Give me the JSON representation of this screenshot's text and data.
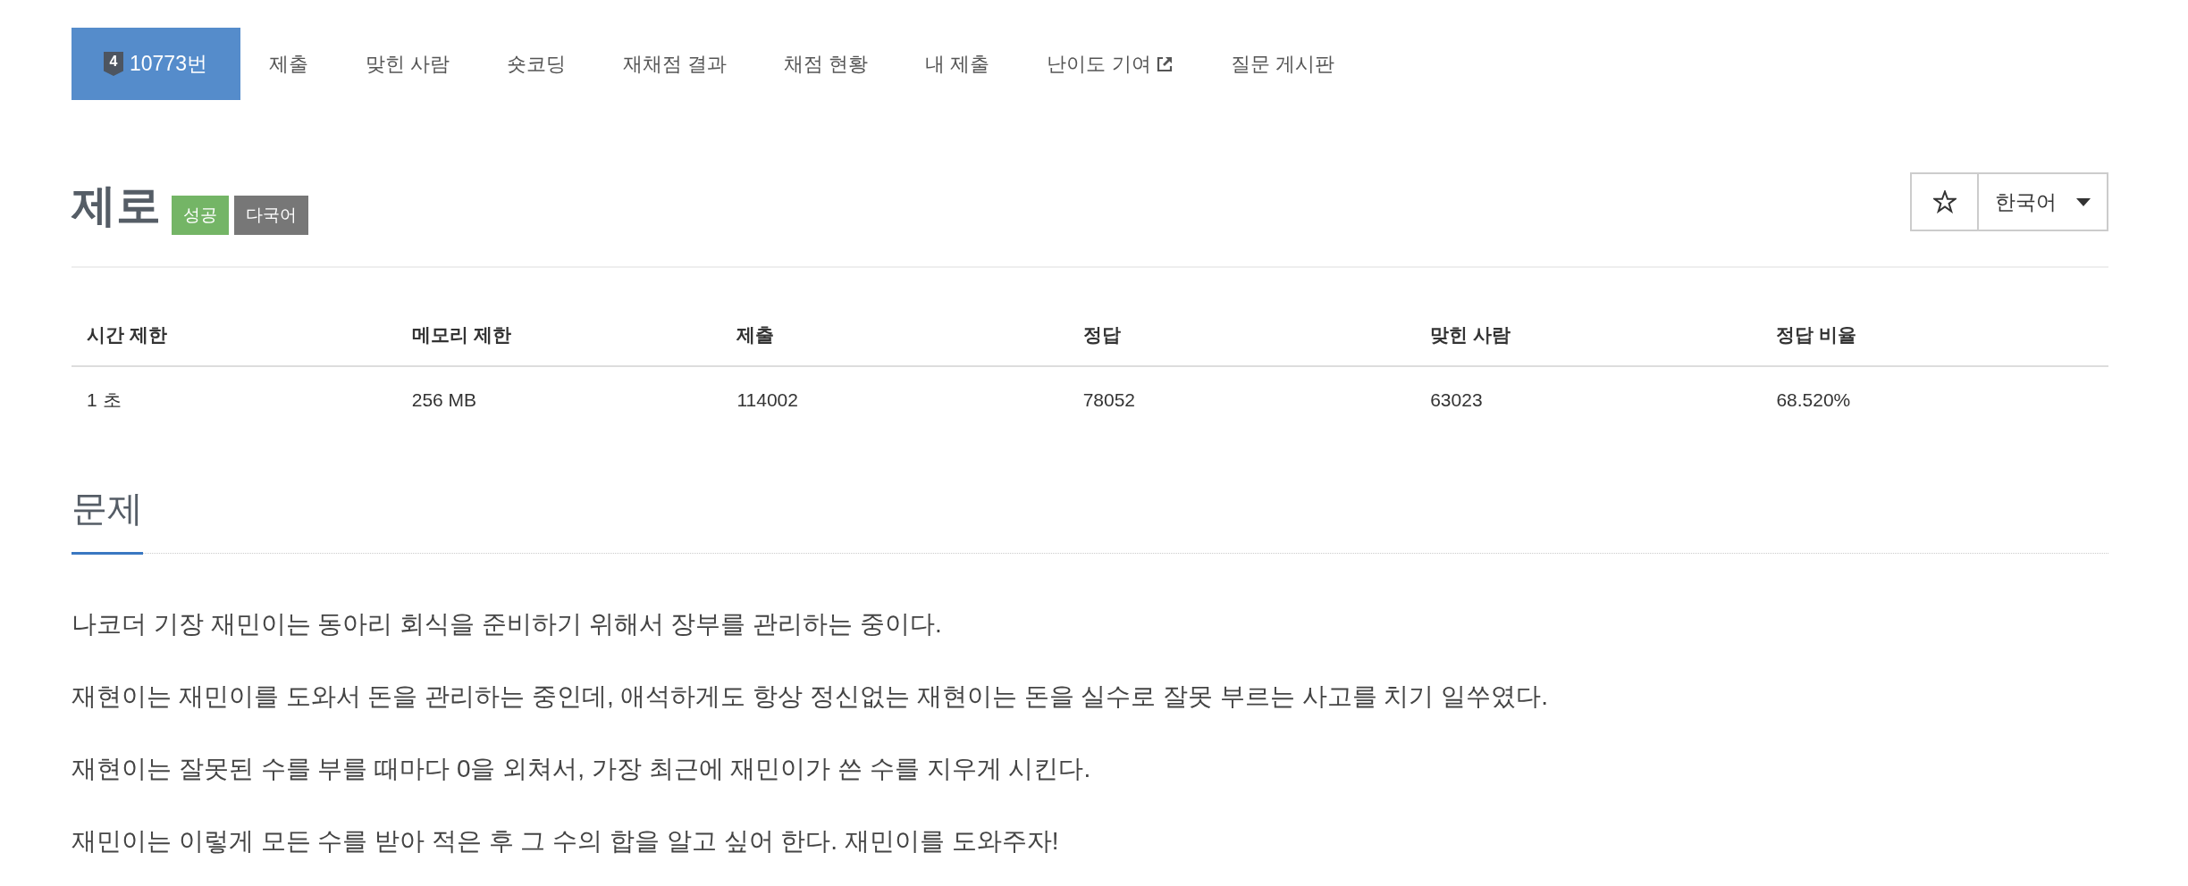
{
  "nav": {
    "tabs": [
      {
        "label": "10773번",
        "tier": "4",
        "selected": true,
        "external": false
      },
      {
        "label": "제출",
        "selected": false,
        "external": false
      },
      {
        "label": "맞힌 사람",
        "selected": false,
        "external": false
      },
      {
        "label": "숏코딩",
        "selected": false,
        "external": false
      },
      {
        "label": "재채점 결과",
        "selected": false,
        "external": false
      },
      {
        "label": "채점 현황",
        "selected": false,
        "external": false
      },
      {
        "label": "내 제출",
        "selected": false,
        "external": false
      },
      {
        "label": "난이도 기여",
        "selected": false,
        "external": true
      },
      {
        "label": "질문 게시판",
        "selected": false,
        "external": false
      }
    ]
  },
  "problem": {
    "title": "제로",
    "labels": [
      {
        "text": "성공",
        "color": "#74b566"
      },
      {
        "text": "다국어",
        "color": "#777777"
      }
    ],
    "favorite": {
      "on": false
    },
    "language": {
      "value": "한국어"
    }
  },
  "limits_table": {
    "columns": [
      "시간 제한",
      "메모리 제한",
      "제출",
      "정답",
      "맞힌 사람",
      "정답 비율"
    ],
    "rows": [
      [
        "1 초",
        "256 MB",
        "114002",
        "78052",
        "63023",
        "68.520%"
      ]
    ]
  },
  "description": {
    "heading": "문제",
    "paragraphs": [
      "나코더 기장 재민이는 동아리 회식을 준비하기 위해서 장부를 관리하는 중이다.",
      "재현이는 재민이를 도와서 돈을 관리하는 중인데, 애석하게도 항상 정신없는 재현이는 돈을 실수로 잘못 부르는 사고를 치기 일쑤였다.",
      "재현이는 잘못된 수를 부를 때마다 0을 외쳐서, 가장 최근에 재민이가 쓴 수를 지우게 시킨다.",
      "재민이는 이렇게 모든 수를 받아 적은 후 그 수의 합을 알고 싶어 한다. 재민이를 도와주자!"
    ]
  }
}
